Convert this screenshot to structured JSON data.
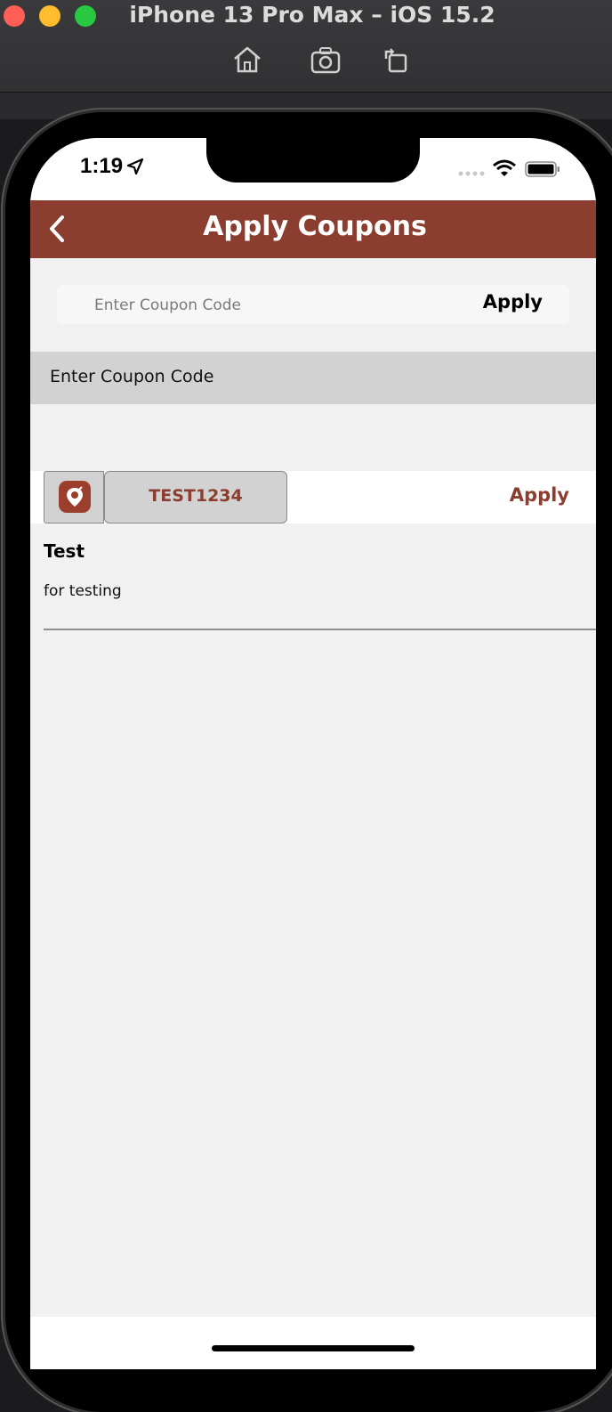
{
  "simulator": {
    "title": "iPhone 13 Pro Max – iOS 15.2",
    "tools": [
      "home-icon",
      "screenshot-icon",
      "rotate-icon"
    ]
  },
  "status_bar": {
    "time": "1:19"
  },
  "nav": {
    "title": "Apply Coupons",
    "back_icon": "chevron-left-icon",
    "color": "#8b3e2f"
  },
  "coupon_entry": {
    "placeholder": "Enter Coupon Code",
    "value": "",
    "apply_label": "Apply"
  },
  "section": {
    "header": "Enter Coupon Code"
  },
  "coupons": [
    {
      "code": "TEST1234",
      "apply_label": "Apply",
      "title": "Test",
      "description": "for testing"
    }
  ]
}
